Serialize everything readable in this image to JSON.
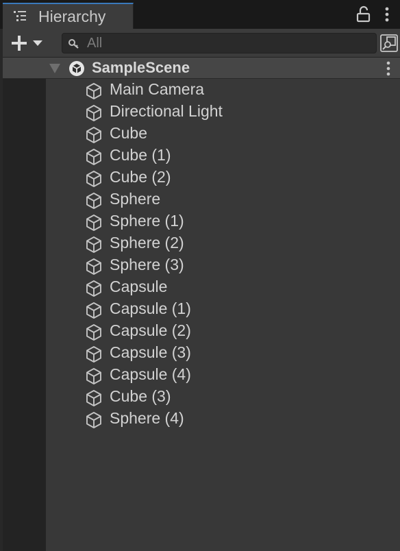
{
  "window": {
    "tab_title": "Hierarchy",
    "tab_icon": "hierarchy-list-icon",
    "lock_icon": "lock-icon",
    "more_icon": "kebab-menu-icon"
  },
  "toolbar": {
    "create_icon": "plus-icon",
    "create_dropdown_icon": "caret-down-icon",
    "search_placeholder": "All",
    "search_icon": "search-icon",
    "search_mode_icon": "search-scene-icon"
  },
  "scene": {
    "name": "SampleScene",
    "icon": "unity-scene-icon",
    "expanded": true
  },
  "objects": [
    {
      "label": "Main Camera"
    },
    {
      "label": "Directional Light"
    },
    {
      "label": "Cube"
    },
    {
      "label": "Cube (1)"
    },
    {
      "label": "Cube (2)"
    },
    {
      "label": "Sphere"
    },
    {
      "label": "Sphere (1)"
    },
    {
      "label": "Sphere (2)"
    },
    {
      "label": "Sphere (3)"
    },
    {
      "label": "Capsule"
    },
    {
      "label": "Capsule (1)"
    },
    {
      "label": "Capsule (2)"
    },
    {
      "label": "Capsule (3)"
    },
    {
      "label": "Capsule (4)"
    },
    {
      "label": "Cube (3)"
    },
    {
      "label": "Sphere (4)"
    }
  ],
  "colors": {
    "tab_accent": "#3a79bb",
    "panel_bg": "#383838",
    "selected_row_bg": "#464646"
  }
}
